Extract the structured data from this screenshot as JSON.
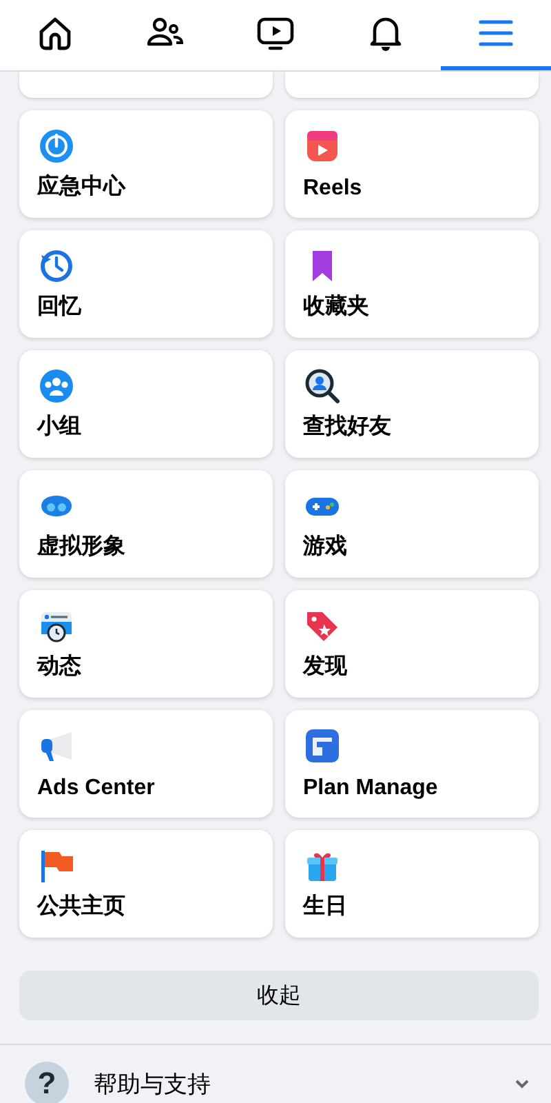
{
  "nav_tabs": [
    {
      "kind": "home",
      "selected": false
    },
    {
      "kind": "friends",
      "selected": false
    },
    {
      "kind": "video",
      "selected": false
    },
    {
      "kind": "bell",
      "selected": false
    },
    {
      "kind": "menu",
      "selected": true
    }
  ],
  "shortcuts": [
    {
      "label": "应急中心"
    },
    {
      "label": "Reels"
    },
    {
      "label": "回忆"
    },
    {
      "label": "收藏夹"
    },
    {
      "label": "小组"
    },
    {
      "label": "查找好友"
    },
    {
      "label": "虚拟形象"
    },
    {
      "label": "游戏"
    },
    {
      "label": "动态"
    },
    {
      "label": "发现"
    },
    {
      "label": "Ads Center"
    },
    {
      "label": "Plan Manage"
    },
    {
      "label": "公共主页"
    },
    {
      "label": "生日"
    }
  ],
  "collapse_button": "收起",
  "help_row": {
    "glyph": "?",
    "label": "帮助与支持",
    "expanded": false
  }
}
